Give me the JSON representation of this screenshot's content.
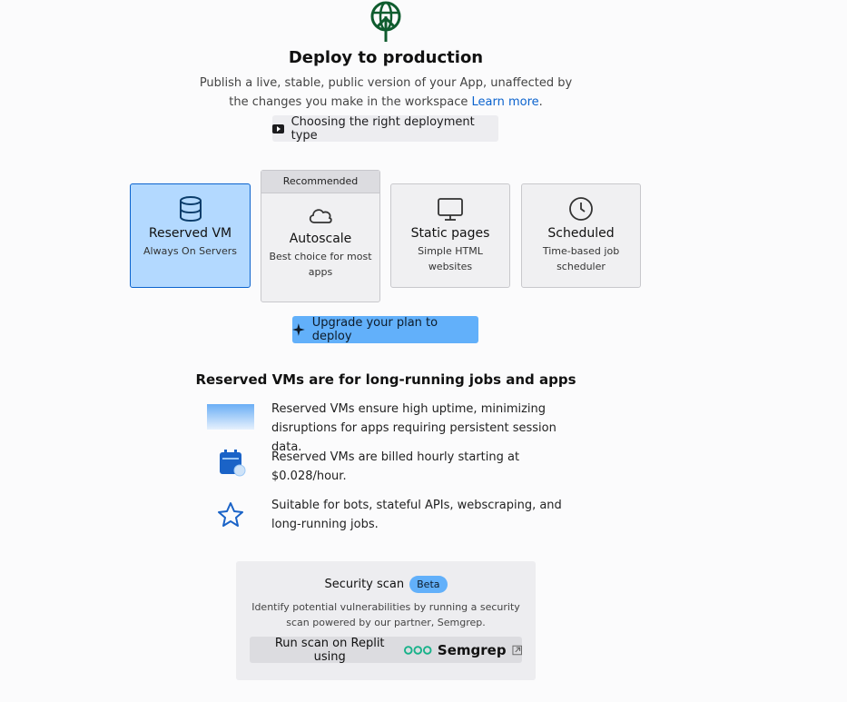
{
  "header": {
    "title": "Deploy to production",
    "subtitle_line1": "Publish a live, stable, public version of your App, unaffected by",
    "subtitle_line2": "the changes you make in the workspace",
    "learn_more": "Learn more",
    "video_button": "Choosing the right deployment type"
  },
  "deployment_types": [
    {
      "name": "Reserved VM",
      "desc": "Always On Servers",
      "selected": true,
      "icon": "database-icon"
    },
    {
      "badge": "Recommended",
      "name": "Autoscale",
      "desc": "Best choice for most apps",
      "icon": "cloud-icon"
    },
    {
      "name": "Static pages",
      "desc": "Simple HTML websites",
      "icon": "monitor-icon"
    },
    {
      "name": "Scheduled",
      "desc": "Time-based job scheduler",
      "icon": "clock-icon"
    }
  ],
  "upgrade_button": "Upgrade your plan to deploy",
  "info": {
    "title": "Reserved VMs are for long-running jobs and apps",
    "features": [
      "Reserved VMs ensure high uptime, minimizing disruptions for apps requiring persistent session data.",
      "Reserved VMs are billed hourly starting at $0.028/hour.",
      "Suitable for bots, stateful APIs, webscraping, and long-running jobs."
    ]
  },
  "security": {
    "title": "Security scan",
    "badge": "Beta",
    "desc": "Identify potential vulnerabilities by running a security scan powered by our partner, Semgrep.",
    "button": "Run scan on Replit using",
    "partner": "Semgrep"
  },
  "colors": {
    "accent": "#62b0fa",
    "selected": "#b3d9ff",
    "link": "#0b63ce",
    "brand_green": "#0f5c2e"
  }
}
